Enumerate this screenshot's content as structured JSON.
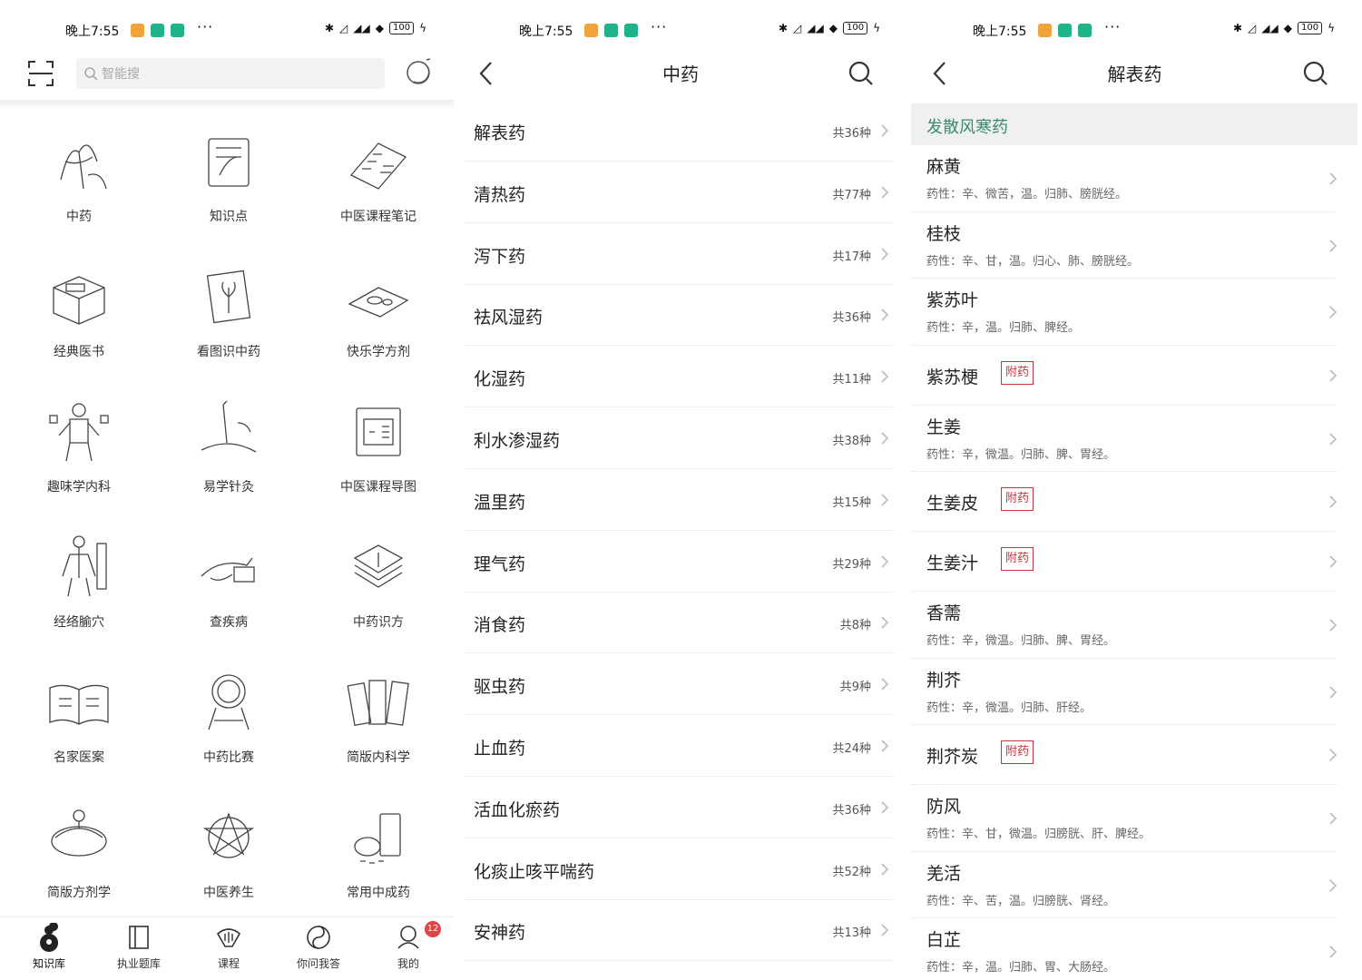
{
  "status_bar": {
    "time": "晚上7:55",
    "battery": "100"
  },
  "panel1": {
    "search_placeholder": "智能搜",
    "grid": [
      {
        "label": "中药",
        "icon": "ginseng-illustration-icon"
      },
      {
        "label": "知识点",
        "icon": "scroll-brush-illustration-icon"
      },
      {
        "label": "中医课程笔记",
        "icon": "open-book-illustration-icon"
      },
      {
        "label": "经典医书",
        "icon": "book-case-illustration-icon"
      },
      {
        "label": "看图识中药",
        "icon": "herb-card-illustration-icon"
      },
      {
        "label": "快乐学方剂",
        "icon": "herb-plate-illustration-icon"
      },
      {
        "label": "趣味学内科",
        "icon": "anatomy-illustration-icon"
      },
      {
        "label": "易学针灸",
        "icon": "acupuncture-illustration-icon"
      },
      {
        "label": "中医课程导图",
        "icon": "mindmap-scroll-illustration-icon"
      },
      {
        "label": "经络腧穴",
        "icon": "meridian-figure-illustration-icon"
      },
      {
        "label": "查疾病",
        "icon": "pulse-diagnosis-illustration-icon"
      },
      {
        "label": "中药识方",
        "icon": "prescription-papers-illustration-icon"
      },
      {
        "label": "名家医案",
        "icon": "case-book-illustration-icon"
      },
      {
        "label": "中药比赛",
        "icon": "trophy-mirror-illustration-icon"
      },
      {
        "label": "简版内科学",
        "icon": "stacked-books-illustration-icon"
      },
      {
        "label": "简版方剂学",
        "icon": "bowl-illustration-icon"
      },
      {
        "label": "中医养生",
        "icon": "five-elements-illustration-icon"
      },
      {
        "label": "常用中成药",
        "icon": "medicine-jar-illustration-icon"
      }
    ],
    "tabs": [
      {
        "label": "知识库",
        "icon": "gourd-icon",
        "active": true
      },
      {
        "label": "执业题库",
        "icon": "book-icon",
        "active": false
      },
      {
        "label": "课程",
        "icon": "fan-icon",
        "active": false
      },
      {
        "label": "你问我答",
        "icon": "yinyang-icon",
        "active": false
      },
      {
        "label": "我的",
        "icon": "profile-icon",
        "active": false,
        "badge": "12"
      }
    ]
  },
  "panel2": {
    "title": "中药",
    "categories": [
      {
        "name": "解表药",
        "count": "共36种"
      },
      {
        "name": "清热药",
        "count": "共77种"
      },
      {
        "name": "泻下药",
        "count": "共17种"
      },
      {
        "name": "祛风湿药",
        "count": "共36种"
      },
      {
        "name": "化湿药",
        "count": "共11种"
      },
      {
        "name": "利水渗湿药",
        "count": "共38种"
      },
      {
        "name": "温里药",
        "count": "共15种"
      },
      {
        "name": "理气药",
        "count": "共29种"
      },
      {
        "name": "消食药",
        "count": "共8种"
      },
      {
        "name": "驱虫药",
        "count": "共9种"
      },
      {
        "name": "止血药",
        "count": "共24种"
      },
      {
        "name": "活血化瘀药",
        "count": "共36种"
      },
      {
        "name": "化痰止咳平喘药",
        "count": "共52种"
      },
      {
        "name": "安神药",
        "count": "共13种"
      }
    ]
  },
  "panel3": {
    "title": "解表药",
    "section": "发散风寒药",
    "herbs": [
      {
        "name": "麻黄",
        "prop": "药性：辛、微苦，温。归肺、膀胱经。"
      },
      {
        "name": "桂枝",
        "prop": "药性：辛、甘，温。归心、肺、膀胱经。"
      },
      {
        "name": "紫苏叶",
        "prop": "药性：辛，温。归肺、脾经。"
      },
      {
        "name": "紫苏梗",
        "tag": "附药"
      },
      {
        "name": "生姜",
        "prop": "药性：辛，微温。归肺、脾、胃经。"
      },
      {
        "name": "生姜皮",
        "tag": "附药"
      },
      {
        "name": "生姜汁",
        "tag": "附药"
      },
      {
        "name": "香薷",
        "prop": "药性：辛，微温。归肺、脾、胃经。"
      },
      {
        "name": "荆芥",
        "prop": "药性：辛，微温。归肺、肝经。"
      },
      {
        "name": "荆芥炭",
        "tag": "附药"
      },
      {
        "name": "防风",
        "prop": "药性：辛、甘，微温。归膀胱、肝、脾经。"
      },
      {
        "name": "羌活",
        "prop": "药性：辛、苦，温。归膀胱、肾经。"
      },
      {
        "name": "白芷",
        "prop": "药性：辛，温。归肺、胃、大肠经。"
      }
    ]
  }
}
